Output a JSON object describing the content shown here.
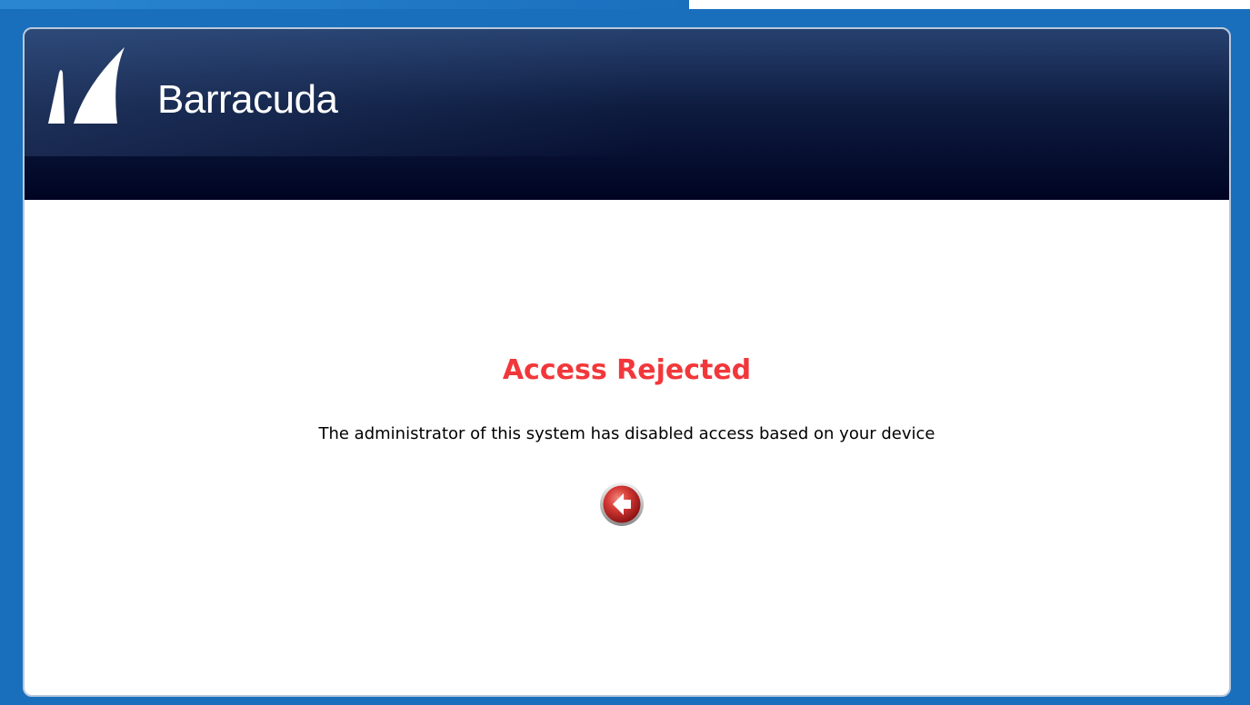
{
  "brand": {
    "name": "Barracuda"
  },
  "main": {
    "title": "Access Rejected",
    "message": "The administrator of this system has disabled access based on your device"
  },
  "icons": {
    "logo": "barracuda-fin-logo",
    "back": "back-arrow-icon"
  },
  "colors": {
    "title": "#f2373a",
    "header_dark": "#000423",
    "page_blue": "#1a6fbd",
    "back_button_red": "#d63a36"
  }
}
